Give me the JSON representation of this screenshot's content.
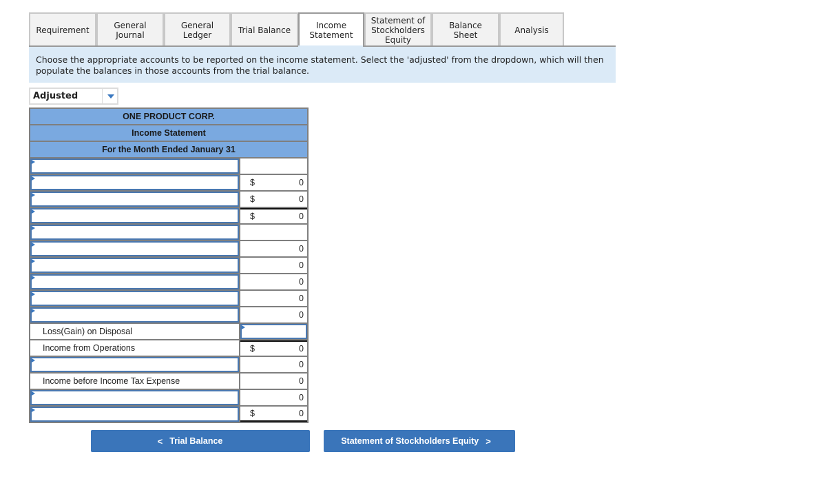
{
  "tabs": [
    {
      "label": "Requirement",
      "active": false
    },
    {
      "label": "General Journal",
      "active": false
    },
    {
      "label": "General Ledger",
      "active": false
    },
    {
      "label": "Trial Balance",
      "active": false
    },
    {
      "label": "Income Statement",
      "active": true
    },
    {
      "label": "Statement of Stockholders Equity",
      "active": false
    },
    {
      "label": "Balance Sheet",
      "active": false
    },
    {
      "label": "Analysis",
      "active": false
    }
  ],
  "instruction": "Choose the appropriate accounts to be reported on the income statement. Select the 'adjusted' from the dropdown, which will then populate the balances in those accounts from the trial balance.",
  "dropdown": {
    "selected": "Adjusted"
  },
  "statement": {
    "company": "ONE PRODUCT CORP.",
    "title": "Income Statement",
    "period": "For the Month Ended January 31",
    "rows": [
      {
        "label": "",
        "label_input": true,
        "currency": "",
        "amount": "",
        "amount_input": false
      },
      {
        "label": "",
        "label_input": true,
        "currency": "$",
        "amount": "0",
        "amount_input": false
      },
      {
        "label": "",
        "label_input": true,
        "currency": "$",
        "amount": "0",
        "amount_input": false
      },
      {
        "label": "",
        "label_input": true,
        "currency": "$",
        "amount": "0",
        "amount_input": false
      },
      {
        "label": "",
        "label_input": true,
        "currency": "",
        "amount": "",
        "amount_input": false
      },
      {
        "label": "",
        "label_input": true,
        "currency": "",
        "amount": "0",
        "amount_input": false
      },
      {
        "label": "",
        "label_input": true,
        "currency": "",
        "amount": "0",
        "amount_input": false
      },
      {
        "label": "",
        "label_input": true,
        "currency": "",
        "amount": "0",
        "amount_input": false
      },
      {
        "label": "",
        "label_input": true,
        "currency": "",
        "amount": "0",
        "amount_input": false
      },
      {
        "label": "",
        "label_input": true,
        "currency": "",
        "amount": "0",
        "amount_input": false
      },
      {
        "label": "Loss(Gain) on Disposal",
        "label_input": false,
        "currency": "",
        "amount": "",
        "amount_input": true
      },
      {
        "label": "Income from Operations",
        "label_input": false,
        "currency": "$",
        "amount": "0",
        "amount_input": false
      },
      {
        "label": "",
        "label_input": true,
        "currency": "",
        "amount": "0",
        "amount_input": false
      },
      {
        "label": "Income before Income Tax Expense",
        "label_input": false,
        "currency": "",
        "amount": "0",
        "amount_input": false
      },
      {
        "label": "",
        "label_input": true,
        "currency": "",
        "amount": "0",
        "amount_input": false
      },
      {
        "label": "",
        "label_input": true,
        "currency": "$",
        "amount": "0",
        "amount_input": false
      }
    ]
  },
  "nav": {
    "prev_label": "Trial Balance",
    "next_label": "Statement of Stockholders Equity",
    "prev_icon": "chevron-left-icon",
    "next_icon": "chevron-right-icon"
  }
}
